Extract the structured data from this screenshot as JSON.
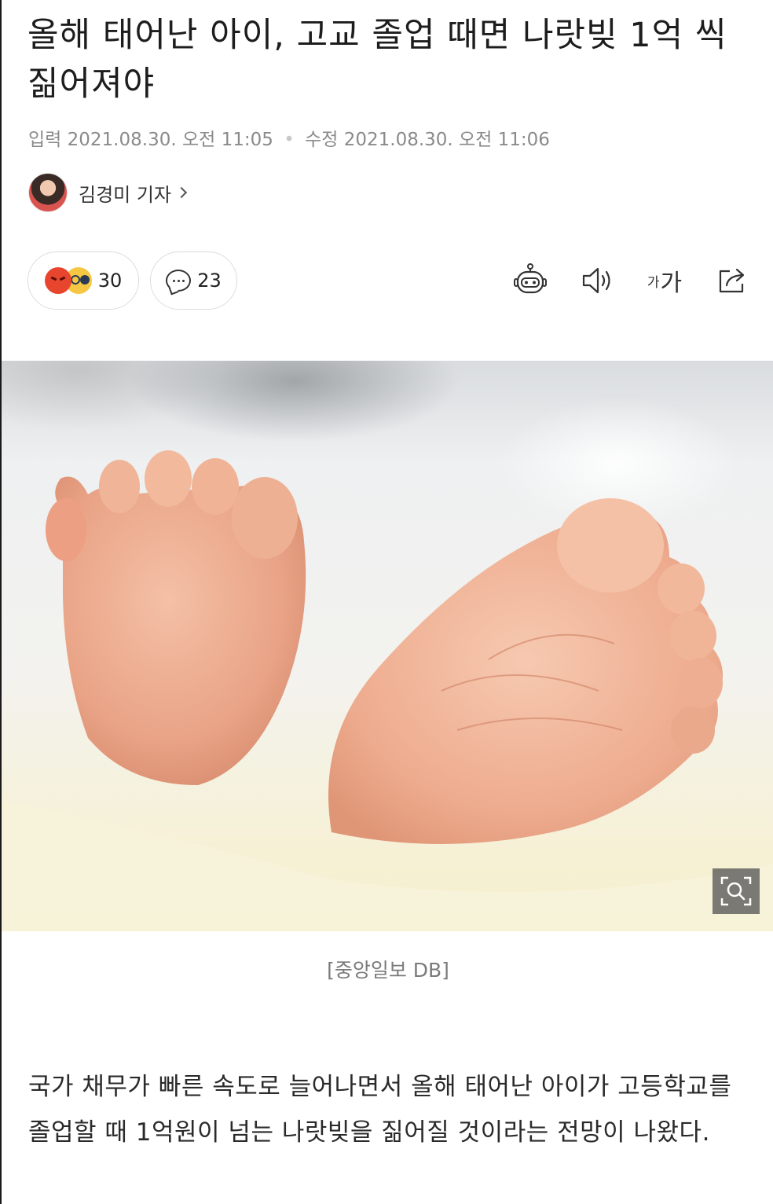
{
  "article": {
    "headline": "올해 태어난 아이, 고교 졸업 때면 나랏빚 1억 씩 짊어져야",
    "meta": {
      "input_label": "입력",
      "input_time": "2021.08.30. 오전 11:05",
      "edit_label": "수정",
      "edit_time": "2021.08.30. 오전 11:06"
    },
    "author": {
      "name": "김경미 기자"
    },
    "reactions": {
      "count": "30",
      "icons": [
        "angry-face-icon",
        "shocked-face-icon"
      ]
    },
    "comments": {
      "count": "23"
    },
    "toolbar": {
      "font_size_small": "가",
      "font_size_large": "가",
      "icons": [
        "summary-bot-icon",
        "speaker-icon",
        "font-size-icon",
        "share-icon"
      ]
    },
    "photo": {
      "caption": "[중앙일보 DB]"
    },
    "body": "국가 채무가 빠른 속도로 늘어나면서 올해 태어난 아이가 고등학교를 졸업할 때 1억원이 넘는 나랏빚을 짊어질 것이라는 전망이 나왔다."
  }
}
